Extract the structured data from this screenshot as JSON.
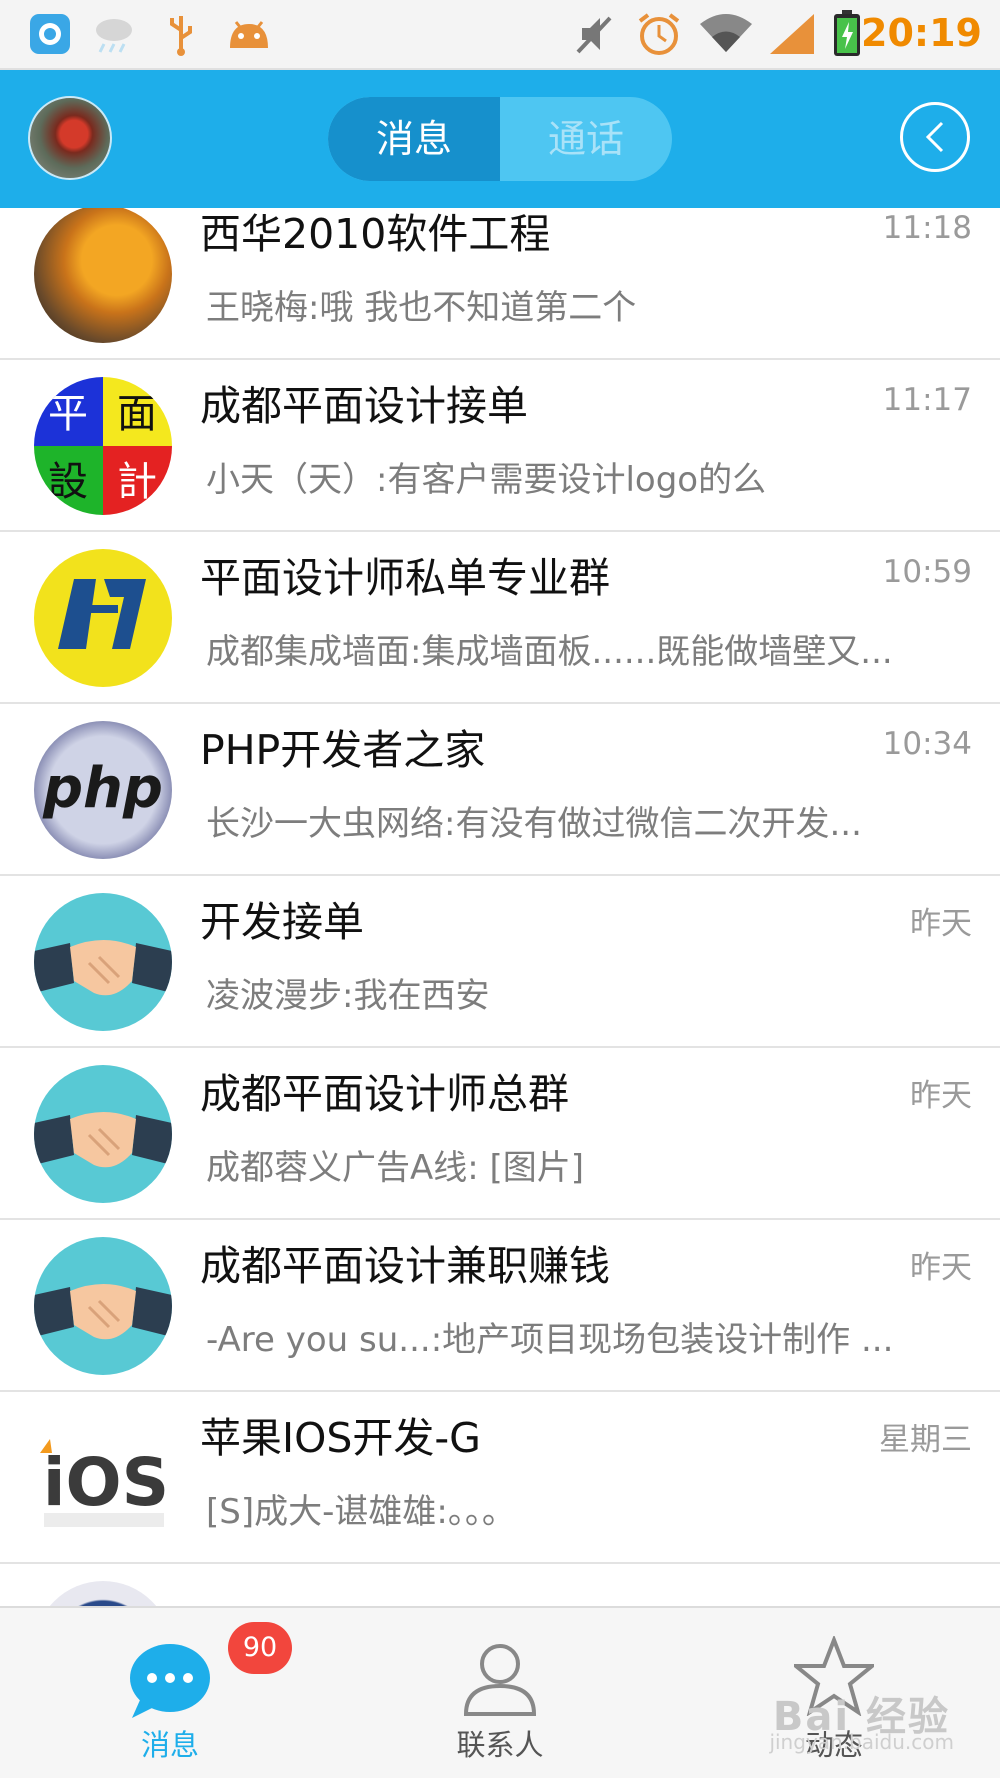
{
  "status_bar": {
    "time": "20:19",
    "icons": [
      "pp-app-icon",
      "weather-icon",
      "usb-icon",
      "android-icon",
      "mute-icon",
      "alarm-icon",
      "wifi-icon",
      "signal-icon",
      "battery-icon"
    ],
    "time_color": "#f08a00"
  },
  "header": {
    "tabs": [
      "消息",
      "通话"
    ],
    "active_tab": "消息",
    "accent": "#1eaeea"
  },
  "conversations": [
    {
      "title": "西华2010软件工程",
      "time": "11:18",
      "message": "王晓梅:哦  我也不知道第二个",
      "avatar": "roof-photo-avatar"
    },
    {
      "title": "成都平面设计接单",
      "time": "11:17",
      "message": "小天（天）:有客户需要设计logo的么",
      "avatar": "design-quad-avatar",
      "avatar_text": [
        "平",
        "面",
        "設",
        "計"
      ]
    },
    {
      "title": "平面设计师私单专业群",
      "time": "10:59",
      "message": "成都集成墙面:集成墙面板......既能做墙壁又...",
      "avatar": "yellow-logo-avatar"
    },
    {
      "title": "PHP开发者之家",
      "time": "10:34",
      "message": "长沙一大虫网络:有没有做过微信二次开发...",
      "avatar": "php-avatar",
      "avatar_text": "php"
    },
    {
      "title": "开发接单",
      "time": "昨天",
      "message": "凌波漫步:我在西安",
      "avatar": "handshake-avatar"
    },
    {
      "title": "成都平面设计师总群",
      "time": "昨天",
      "message": "成都蓉义广告A线: [图片]",
      "avatar": "handshake-avatar"
    },
    {
      "title": "成都平面设计兼职赚钱",
      "time": "昨天",
      "message": "-Are you su...:地产项目现场包装设计制作 ...",
      "avatar": "handshake-avatar"
    },
    {
      "title": "苹果IOS开发-G",
      "time": "星期三",
      "message": "[S]成大-谌雄雄:。。。",
      "avatar": "ios-avatar",
      "avatar_text": "iOS"
    },
    {
      "title": "rtx_partial_row",
      "time": "",
      "message": "",
      "avatar": "emblem-avatar"
    }
  ],
  "bottom_nav": {
    "items": [
      {
        "label": "消息",
        "icon": "chat-bubble-icon",
        "badge": "90"
      },
      {
        "label": "联系人",
        "icon": "person-icon"
      },
      {
        "label": "动态",
        "icon": "star-icon"
      }
    ]
  },
  "watermark": {
    "main": "Bai 经验",
    "sub": "jingyan.baidu.com"
  }
}
